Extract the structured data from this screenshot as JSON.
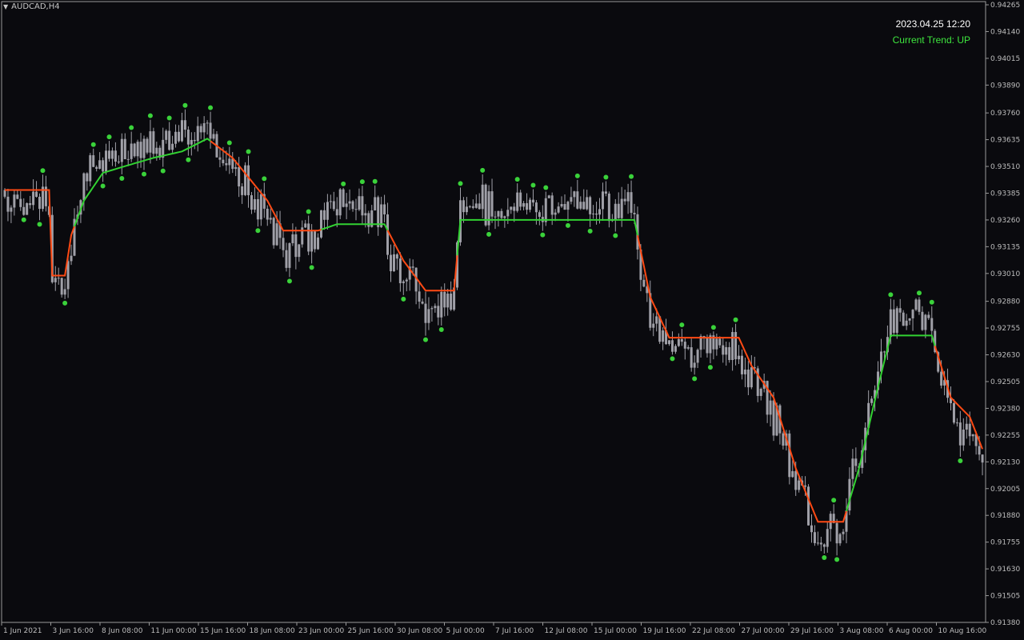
{
  "symbol": "AUDCAD,H4",
  "datetime": "2023.04.25 12:20",
  "trend_text": "Current Trend: UP",
  "colors": {
    "background": "#0a0a0e",
    "candle": "#a0a0a8",
    "up_line": "#32d232",
    "down_line": "#ff4a14",
    "dot": "#3ad23a",
    "axis_text": "#bdbdbd"
  },
  "chart_data": {
    "type": "line",
    "ylim": [
      0.9138,
      0.9428
    ],
    "y_ticks": [
      "0.94265",
      "0.94140",
      "0.94015",
      "0.93890",
      "0.93760",
      "0.93635",
      "0.93510",
      "0.93385",
      "0.93260",
      "0.93135",
      "0.93010",
      "0.92880",
      "0.92755",
      "0.92630",
      "0.92505",
      "0.92380",
      "0.92255",
      "0.92130",
      "0.92005",
      "0.91880",
      "0.91755",
      "0.91630",
      "0.91505",
      "0.91380"
    ],
    "x_ticks": [
      "1 Jun 2021",
      "3 Jun 16:00",
      "8 Jun 08:00",
      "11 Jun 00:00",
      "15 Jun 16:00",
      "18 Jun 08:00",
      "23 Jun 00:00",
      "25 Jun 16:00",
      "30 Jun 08:00",
      "5 Jul 00:00",
      "7 Jul 16:00",
      "12 Jul 08:00",
      "15 Jul 00:00",
      "19 Jul 16:00",
      "22 Jul 08:00",
      "27 Jul 00:00",
      "29 Jul 16:00",
      "3 Aug 08:00",
      "6 Aug 00:00",
      "10 Aug 16:00"
    ],
    "trend_line": [
      {
        "x": 0,
        "y": 0.934,
        "trend": "down"
      },
      {
        "x": 14,
        "y": 0.934,
        "trend": "down"
      },
      {
        "x": 15,
        "y": 0.93,
        "trend": "down"
      },
      {
        "x": 19,
        "y": 0.93,
        "trend": "down"
      },
      {
        "x": 21,
        "y": 0.9319,
        "trend": "up"
      },
      {
        "x": 25,
        "y": 0.9335,
        "trend": "up"
      },
      {
        "x": 31,
        "y": 0.9348,
        "trend": "up"
      },
      {
        "x": 40,
        "y": 0.9352,
        "trend": "up"
      },
      {
        "x": 47,
        "y": 0.9355,
        "trend": "up"
      },
      {
        "x": 56,
        "y": 0.9358,
        "trend": "up"
      },
      {
        "x": 64,
        "y": 0.9364,
        "trend": "down"
      },
      {
        "x": 72,
        "y": 0.9355,
        "trend": "down"
      },
      {
        "x": 83,
        "y": 0.9335,
        "trend": "down"
      },
      {
        "x": 88,
        "y": 0.9321,
        "trend": "down"
      },
      {
        "x": 99,
        "y": 0.9321,
        "trend": "up"
      },
      {
        "x": 105,
        "y": 0.9324,
        "trend": "up"
      },
      {
        "x": 120,
        "y": 0.9324,
        "trend": "down"
      },
      {
        "x": 126,
        "y": 0.9307,
        "trend": "down"
      },
      {
        "x": 133,
        "y": 0.9293,
        "trend": "down"
      },
      {
        "x": 142,
        "y": 0.9293,
        "trend": "up"
      },
      {
        "x": 144,
        "y": 0.9326,
        "trend": "up"
      },
      {
        "x": 199,
        "y": 0.9326,
        "trend": "down"
      },
      {
        "x": 204,
        "y": 0.929,
        "trend": "down"
      },
      {
        "x": 210,
        "y": 0.9271,
        "trend": "down"
      },
      {
        "x": 232,
        "y": 0.9271,
        "trend": "down"
      },
      {
        "x": 236,
        "y": 0.9258,
        "trend": "down"
      },
      {
        "x": 243,
        "y": 0.9243,
        "trend": "down"
      },
      {
        "x": 250,
        "y": 0.921,
        "trend": "down"
      },
      {
        "x": 257,
        "y": 0.9185,
        "trend": "down"
      },
      {
        "x": 265,
        "y": 0.9185,
        "trend": "up"
      },
      {
        "x": 270,
        "y": 0.921,
        "trend": "up"
      },
      {
        "x": 276,
        "y": 0.9248,
        "trend": "up"
      },
      {
        "x": 280,
        "y": 0.9272,
        "trend": "up"
      },
      {
        "x": 293,
        "y": 0.9272,
        "trend": "down"
      },
      {
        "x": 299,
        "y": 0.9243,
        "trend": "down"
      },
      {
        "x": 305,
        "y": 0.9234,
        "trend": "down"
      },
      {
        "x": 309,
        "y": 0.9219,
        "trend": "down"
      }
    ]
  }
}
